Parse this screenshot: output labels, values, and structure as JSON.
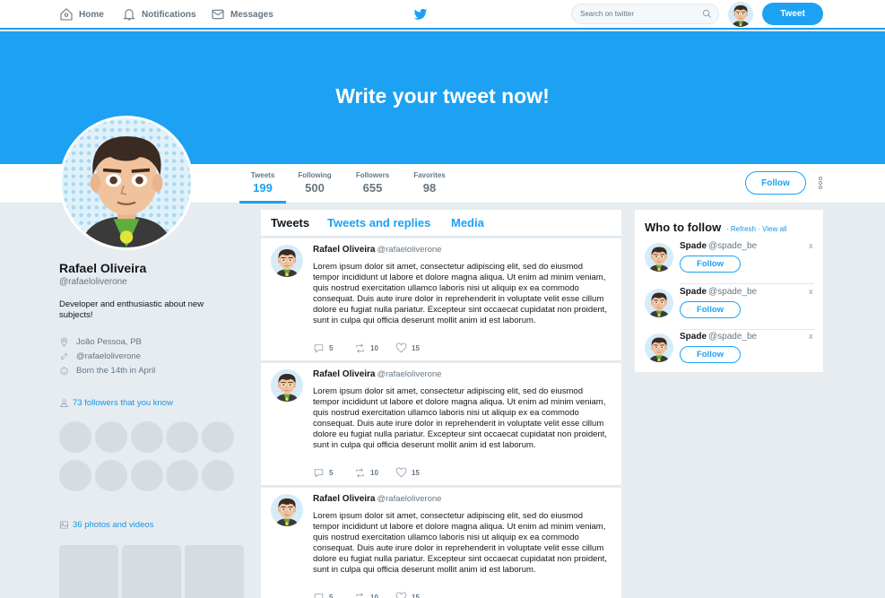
{
  "nav": {
    "home": "Home",
    "notifications": "Notifications",
    "messages": "Messages",
    "search_placeholder": "Search on twitter",
    "tweet_button": "Tweet"
  },
  "banner": {
    "text": "Write your tweet now!"
  },
  "stats": [
    {
      "label": "Tweets",
      "value": "199"
    },
    {
      "label": "Following",
      "value": "500"
    },
    {
      "label": "Followers",
      "value": "655"
    },
    {
      "label": "Favorites",
      "value": "98"
    }
  ],
  "profile": {
    "name": "Rafael Oliveira",
    "handle": "@rafaeloliverone",
    "bio": "Developer and enthusiastic about new subjects!",
    "location": "João Pessoa, PB",
    "link": "@rafaeloliverone",
    "birthday": "Born the 14th in April",
    "followers_you_know": "73 followers that you know",
    "photos_videos": "36 photos and videos",
    "follow_button": "Follow"
  },
  "timeline": {
    "tabs": [
      "Tweets",
      "Tweets and replies",
      "Media"
    ],
    "tweets": [
      {
        "name": "Rafael Oliveira",
        "handle": "@rafaeloliverone",
        "text": "Lorem ipsum dolor sit amet, consectetur adipiscing elit, sed do eiusmod tempor incididunt ut labore et dolore magna aliqua. Ut enim ad minim veniam, quis nostrud exercitation ullamco laboris nisi ut aliquip ex ea commodo consequat. Duis aute irure dolor in reprehenderit in voluptate velit esse cillum dolore eu fugiat nulla pariatur. Excepteur sint occaecat cupidatat non proident, sunt in culpa qui officia deserunt mollit anim id est laborum.",
        "replies": "5",
        "retweets": "10",
        "likes": "15"
      },
      {
        "name": "Rafael Oliveira",
        "handle": "@rafaeloliverone",
        "text": "Lorem ipsum dolor sit amet, consectetur adipiscing elit, sed do eiusmod tempor incididunt ut labore et dolore magna aliqua. Ut enim ad minim veniam, quis nostrud exercitation ullamco laboris nisi ut aliquip ex ea commodo consequat. Duis aute irure dolor in reprehenderit in voluptate velit esse cillum dolore eu fugiat nulla pariatur. Excepteur sint occaecat cupidatat non proident, sunt in culpa qui officia deserunt mollit anim id est laborum.",
        "replies": "5",
        "retweets": "10",
        "likes": "15"
      },
      {
        "name": "Rafael Oliveira",
        "handle": "@rafaeloliverone",
        "text": "Lorem ipsum dolor sit amet, consectetur adipiscing elit, sed do eiusmod tempor incididunt ut labore et dolore magna aliqua. Ut enim ad minim veniam, quis nostrud exercitation ullamco laboris nisi ut aliquip ex ea commodo consequat. Duis aute irure dolor in reprehenderit in voluptate velit esse cillum dolore eu fugiat nulla pariatur. Excepteur sint occaecat cupidatat non proident, sunt in culpa qui officia deserunt mollit anim id est laborum.",
        "replies": "5",
        "retweets": "10",
        "likes": "15"
      }
    ]
  },
  "who_to_follow": {
    "title": "Who to follow",
    "sep": "·",
    "refresh": "Refresh",
    "view_all": "View all",
    "suggestions": [
      {
        "name": "Spade",
        "handle": "@spade_be",
        "follow": "Follow",
        "dismiss": "x"
      },
      {
        "name": "Spade",
        "handle": "@spade_be",
        "follow": "Follow",
        "dismiss": "x"
      },
      {
        "name": "Spade",
        "handle": "@spade_be",
        "follow": "Follow",
        "dismiss": "x"
      }
    ]
  },
  "colors": {
    "accent": "#1da1f2",
    "background": "#e6ecf0",
    "placeholder": "#d5dde3"
  },
  "icons": [
    "home-icon",
    "bell-icon",
    "mail-icon",
    "twitter-bird-icon",
    "search-icon",
    "location-icon",
    "link-icon",
    "birthday-icon",
    "followers-icon",
    "photos-icon",
    "reply-icon",
    "retweet-icon",
    "heart-icon",
    "more-icon"
  ]
}
